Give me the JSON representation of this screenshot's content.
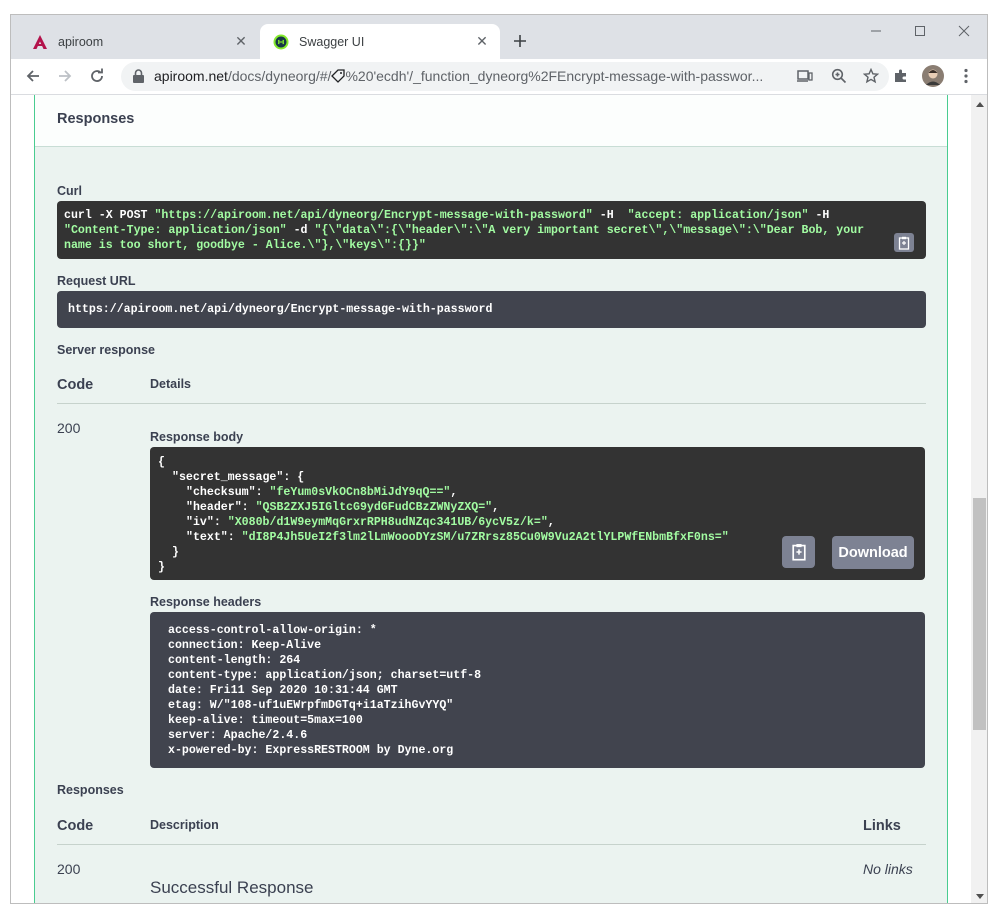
{
  "browser": {
    "tabs": [
      {
        "title": "apiroom",
        "icon": "apiroom-logo-icon",
        "active": false
      },
      {
        "title": "Swagger UI",
        "icon": "swagger-logo-icon",
        "active": true
      }
    ],
    "url": {
      "domain": "apiroom.net",
      "path": "/docs/dyneorg/#/",
      "after_icon": "%20'ecdh'/_function_dyneorg%2FEncrypt-message-with-passwor..."
    }
  },
  "swagger": {
    "responses_header": "Responses",
    "curl_label": "Curl",
    "curl_lines": [
      {
        "cmd": "curl -X POST ",
        "str": "\"https://apiroom.net/api/dyneorg/Encrypt-message-with-password\"",
        "tail": " -H  ",
        "str2": "\"accept: application/json\"",
        "tail2": " -H"
      },
      {
        "cmd": "",
        "str": "\"Content-Type: application/json\"",
        "tail": " -d ",
        "str2": "\"{\\\"data\\\":{\\\"header\\\":\\\"A very important secret\\\",\\\"message\\\":\\\"Dear Bob, your",
        "tail2": ""
      },
      {
        "cmd": "",
        "str": "name is too short, goodbye - Alice.\\\"},\\\"keys\\\":{}}\"",
        "tail": "",
        "str2": "",
        "tail2": ""
      }
    ],
    "request_url_label": "Request URL",
    "request_url": "https://apiroom.net/api/dyneorg/Encrypt-message-with-password",
    "server_response_label": "Server response",
    "code_header": "Code",
    "details_header": "Details",
    "response_code": "200",
    "response_body_label": "Response body",
    "response_body": {
      "open": "{",
      "key_secret": "\"secret_message\": {",
      "checksum_key": "\"checksum\": ",
      "checksum_val": "\"feYum0sVkOCn8bMiJdY9qQ==\"",
      "header_key": "\"header\": ",
      "header_val": "\"QSB2ZXJ5IGltcG9ydGFudCBzZWNyZXQ=\"",
      "iv_key": "\"iv\": ",
      "iv_val": "\"X080b/d1W9eymMqGrxrRPH8udNZqc341UB/6ycV5z/k=\"",
      "text_key": "\"text\": ",
      "text_val": "\"dI8P4Jh5UeI2f3lm2lLmWoooDYzSM/u7ZRrsz85Cu0W9Vu2A2tlYLPWfENbmBfxF0ns=\"",
      "inner_close": "}",
      "close": "}"
    },
    "download_label": "Download",
    "response_headers_label": "Response headers",
    "response_headers": [
      "access-control-allow-origin: *",
      "connection: Keep-Alive",
      "content-length: 264",
      "content-type: application/json; charset=utf-8",
      "date: Fri11 Sep 2020 10:31:44 GMT",
      "etag: W/\"108-uf1uEWrpfmDGTq+i1aTzihGvYYQ\"",
      "keep-alive: timeout=5max=100",
      "server: Apache/2.4.6",
      "x-powered-by: ExpressRESTROOM by Dyne.org"
    ],
    "responses_label": "Responses",
    "description_header": "Description",
    "links_header": "Links",
    "doc_code": "200",
    "doc_description": "Successful Response",
    "no_links": "No links"
  },
  "colors": {
    "post_green": "#49cc90",
    "code_bg": "#333333",
    "headers_bg": "#41444e",
    "string_green": "#a2fca2",
    "opblock_bg": "#ebf3f0"
  }
}
